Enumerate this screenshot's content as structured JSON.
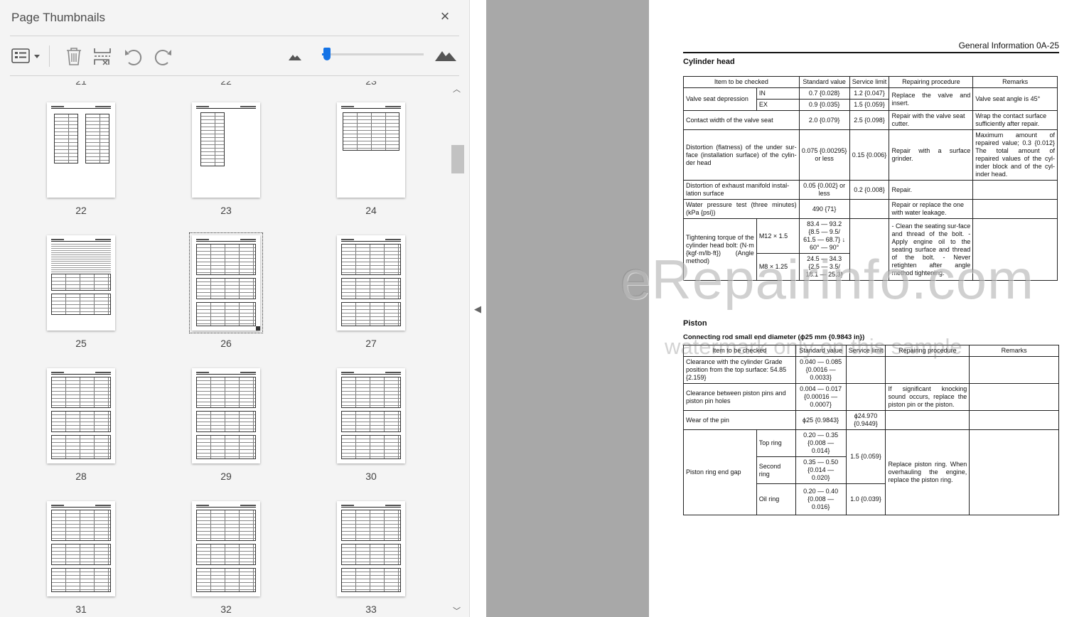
{
  "panel": {
    "title": "Page Thumbnails",
    "close_icon": "×",
    "toolbar": {
      "options_icon": "thumbnail-options-icon",
      "delete_icon": "trash-icon",
      "insert_icon": "insert-page-icon",
      "rotate_ccw_icon": "rotate-counterclockwise-icon",
      "rotate_cw_icon": "rotate-clockwise-icon",
      "zoom_out_icon": "mountain-small-icon",
      "zoom_in_icon": "mountain-large-icon",
      "zoom_level": 0.03,
      "accent": "#1473e6"
    },
    "cut_labels": [
      "21",
      "22",
      "23"
    ],
    "thumbnails": [
      "22",
      "23",
      "24",
      "25",
      "26",
      "27",
      "28",
      "29",
      "30",
      "31",
      "32",
      "33"
    ],
    "selected": "26"
  },
  "doc": {
    "header": "General Information 0A-25",
    "cylinder_head": {
      "title": "Cylinder head",
      "head": [
        "Item to be checked",
        "Standard value",
        "Service limit",
        "Repairing procedure",
        "Remarks"
      ],
      "vsd_item": "Valve seat depression",
      "vsd_in": "IN",
      "vsd_in_std": "0.7 {0.028}",
      "vsd_in_lim": "1.2 {0.047}",
      "vsd_ex": "EX",
      "vsd_ex_std": "0.9 {0.035}",
      "vsd_ex_lim": "1.5 {0.059}",
      "vsd_proc": "Replace the valve and insert.",
      "vsd_rem": "Valve seat angle is 45°",
      "cw_item": "Contact width of the valve seat",
      "cw_std": "2.0 {0.079}",
      "cw_lim": "2.5 {0.098}",
      "cw_proc": "Repair with the valve seat cutter.",
      "cw_rem": "Wrap the contact surface sufficiently after repair.",
      "dist_item": "Distortion (flatness) of the under sur-face (installation surface) of the cylin-der head",
      "dist_std": "0.075 {0.00295} or less",
      "dist_lim": "0.15 {0.006}",
      "dist_proc": "Repair with a surface grinder.",
      "dist_rem": "Maximum amount of repaired value; 0.3 {0.012} The total amount of repaired values of the cyl-inder block and of the cyl-inder head.",
      "exh_item": "Distortion of exhaust manifold instal-lation surface",
      "exh_std": "0.05 {0.002} or less",
      "exh_lim": "0.2 {0.008}",
      "exh_proc": "Repair.",
      "wp_item": "Water pressure test (three minutes) (kPa {psi})",
      "wp_std": "490 {71}",
      "wp_proc": "Repair or replace the one with water leakage.",
      "tq_item": "Tightening torque of the cylinder head bolt: (N·m {kgf·m/lb·ft}) (Angle method)",
      "tq_m12": "M12 × 1.5",
      "tq_m12_std": "83.4 — 93.2 {8.5 — 9.5/ 61.5 — 68.7} ↓ 60° — 90°",
      "tq_m8": "M8 × 1.25",
      "tq_m8_std": "24.5 — 34.3 {2.5 — 3.5/ 18.1 — 25.3}",
      "tq_proc": "- Clean the seating sur-face and thread of the bolt. - Apply engine oil to the seating surface and thread of the bolt. - Never retighten after angle method tightening."
    },
    "piston": {
      "title": "Piston",
      "subtitle": "Connecting rod small end diameter (ϕ25 mm {0.9843 in})",
      "head": [
        "Item to be checked",
        "Standard value",
        "Service limit",
        "Repairing procedure",
        "Remarks"
      ],
      "clr_item": "Clearance with the cylinder Grade position from the top surface: 54.85 {2.159}",
      "clr_std": "0.040 — 0.085 {0.0016 — 0.0033}",
      "pp_item": "Clearance between piston pins and piston pin holes",
      "pp_std": "0.004 — 0.017 {0.00016 — 0.0007}",
      "pp_proc": "If significant knocking sound occurs, replace the piston pin or the piston.",
      "wear_item": "Wear of the pin",
      "wear_std": "ϕ25 {0.9843}",
      "wear_lim": "ϕ24.970 {0.9449}",
      "ring_item": "Piston ring end gap",
      "top_ring": "Top ring",
      "top_std": "0.20 — 0.35 {0.008 — 0.014}",
      "second_ring": "Second ring",
      "second_std": "0.35 — 0.50 {0.014 — 0.020}",
      "top_second_lim": "1.5 {0.059}",
      "oil_ring": "Oil ring",
      "oil_std": "0.20 — 0.40 {0.008 — 0.016}",
      "oil_lim": "1.0 {0.039}",
      "ring_proc": "Replace piston ring. When overhauling the engine, replace the piston ring."
    },
    "watermark_main": "eRepairinfo.com",
    "watermark_sub": "watermark only on this sample"
  }
}
